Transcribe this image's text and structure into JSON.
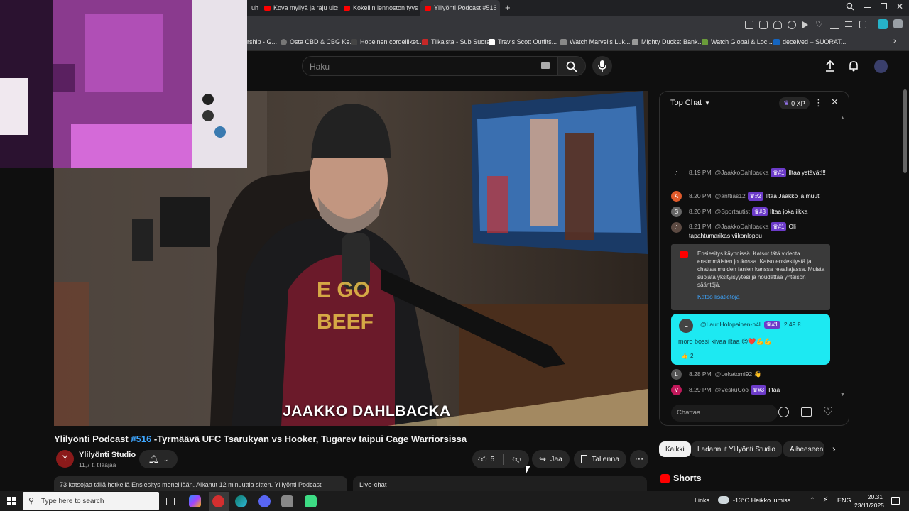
{
  "browser": {
    "tabs": [
      {
        "label": "uhr"
      },
      {
        "label": "Kova myllyä ja raju ulosajo"
      },
      {
        "label": "Kokeilin lennoston fyysistä"
      },
      {
        "label": "Ylilyönti Podcast #516"
      }
    ],
    "bookmarks": [
      {
        "label": "rship - G..."
      },
      {
        "label": "Osta CBD & CBG Ke..."
      },
      {
        "label": "Hopeinen cordelliket..."
      },
      {
        "label": "Tilkaista - Sub Suora"
      },
      {
        "label": "Travis Scott Outfits..."
      },
      {
        "label": "Watch Marvel's Luk..."
      },
      {
        "label": "Mighty Ducks: Bank..."
      },
      {
        "label": "Watch Global & Loc..."
      },
      {
        "label": "deceived – SUORAT..."
      }
    ]
  },
  "header": {
    "search_placeholder": "Haku"
  },
  "video": {
    "lower_third": "JAAKKO DAHLBACKA",
    "title_prefix": "Ylilyönti Podcast ",
    "title_hash": "#516",
    "title_rest": " -Tyrmäävä UFC Tsarukyan vs Hooker, Tugarev taipui Cage Warriorsissa"
  },
  "channel": {
    "name": "Ylilyönti Studio",
    "subs": "11,7 t. tilaajaa",
    "avatar_letter": "Y"
  },
  "actions": {
    "likes": "5",
    "share": "Jaa",
    "save": "Tallenna"
  },
  "description": {
    "text": "73 katsojaa tällä hetkellä  Ensiesitys meneillään. Alkanut 12 minuuttia sitten.  Ylilyönti Podcast"
  },
  "livechat_tab": "Live-chat",
  "chat": {
    "header_title": "Top Chat",
    "xp": "0 XP",
    "input_placeholder": "Chattaa...",
    "messages": [
      {
        "avatar": "J",
        "avatar_color": "#5c4a42",
        "time": "8.19 PM",
        "author": "@JaakkoDahlbacka",
        "badge": "#1",
        "text": "Iltaa ystävät!!!"
      },
      {
        "avatar": "A",
        "avatar_color": "#e05a2b",
        "time": "8.20 PM",
        "author": "@anttias12",
        "badge": "#2",
        "text": "Iltaa Jaakko ja muut"
      },
      {
        "avatar": "S",
        "avatar_color": "#666666",
        "time": "8.20 PM",
        "author": "@Sportautist",
        "badge": "#3",
        "text": "Iltaa joka iikka"
      },
      {
        "avatar": "J",
        "avatar_color": "#5c4a42",
        "time": "8.21 PM",
        "author": "@JaakkoDahlbacka",
        "badge": "#1",
        "text": "Oli tapahtumarikas viikonloppu"
      },
      {
        "avatar": "L",
        "avatar_color": "#555555",
        "time": "8.28 PM",
        "author": "@Lekatomi92",
        "badge": "",
        "text": "👋"
      },
      {
        "avatar": "V",
        "avatar_color": "#c2185b",
        "time": "8.29 PM",
        "author": "@VeskuCoo",
        "badge": "#3",
        "text": "Iltaa"
      }
    ],
    "notice": {
      "text": "Ensiesitys käynnissä. Katsot tätä videota ensimmäisten joukossa. Katso ensiesitystä ja chattaa muiden fanien kanssa reaaliajassa. Muista suojata yksityisyytesi ja noudattaa yhteisön sääntöjä.",
      "link": "Katso lisätietoja"
    },
    "superchat": {
      "avatar": "L",
      "author": "@LauriHolopainen-n4l",
      "badge": "#1",
      "amount": "2,49 €",
      "text": "moro bossi kivaa iltaa 😍❤️💪💪",
      "likes": "2"
    }
  },
  "chips": [
    "Kaikki",
    "Ladannut Ylilyönti Studio",
    "Aiheeseen"
  ],
  "shorts": {
    "title": "Shorts"
  },
  "taskbar": {
    "search_placeholder": "Type here to search",
    "links": "Links",
    "weather": "-13°C  Heikko lumisa...",
    "lang": "ENG",
    "time": "20.31",
    "date": "23/11/2025"
  },
  "colors": {
    "accent_blue": "#3ea6ff",
    "superchat_bg": "#1de9f2",
    "member_badge": "#6c3bc9",
    "yt_red": "#ff0000"
  }
}
